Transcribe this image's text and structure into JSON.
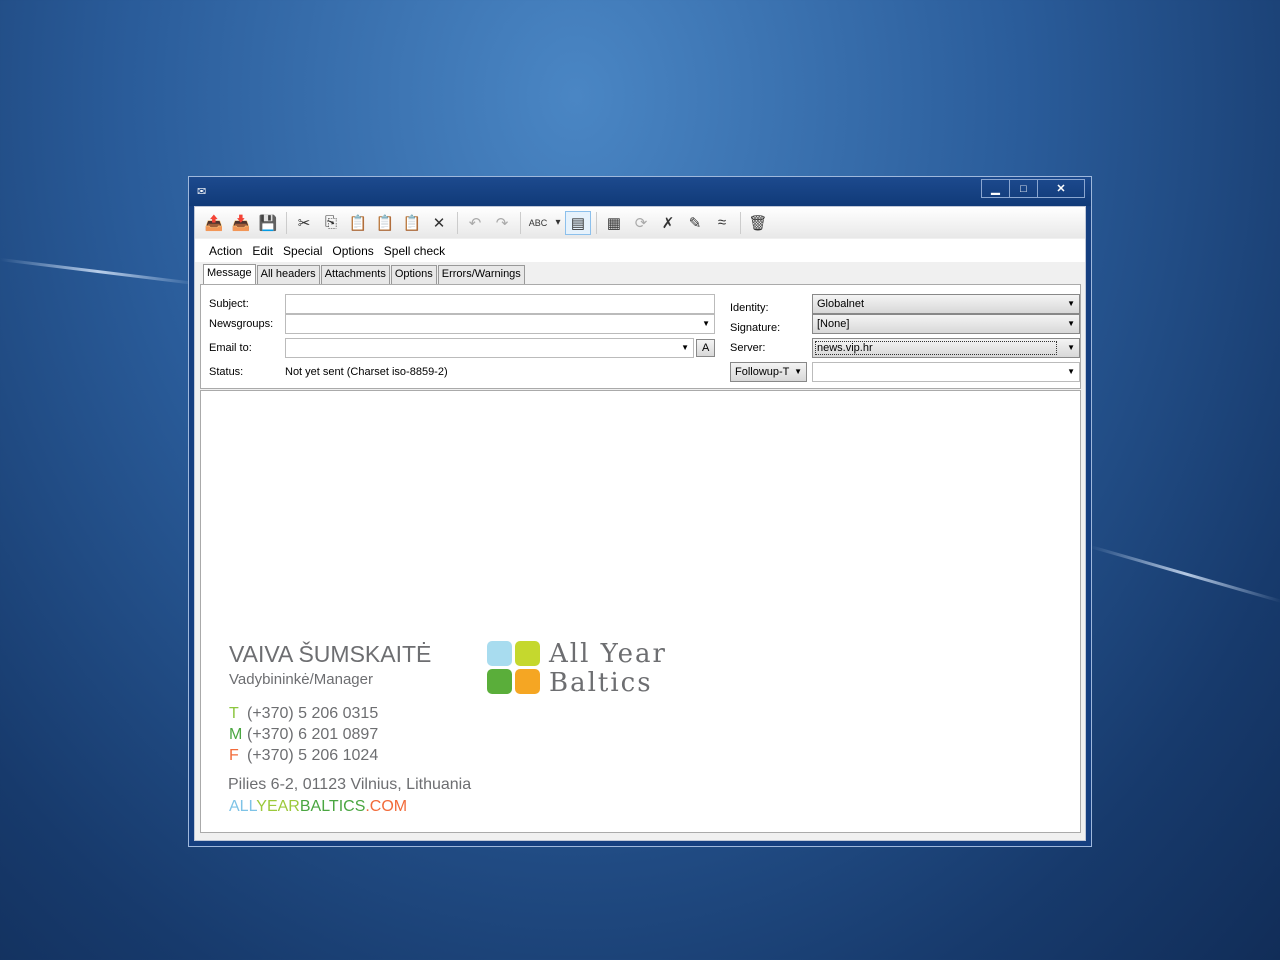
{
  "window": {
    "app_icon": "envelope-icon",
    "minimize": "▁",
    "maximize": "□",
    "close": "✕"
  },
  "toolbar": {
    "buttons": [
      {
        "name": "send-icon",
        "glyph": "📤"
      },
      {
        "name": "send-later-icon",
        "glyph": "📥"
      },
      {
        "name": "save-icon",
        "glyph": "💾"
      },
      {
        "name": "cut-icon",
        "glyph": "✂"
      },
      {
        "name": "copy-icon",
        "glyph": "⎘"
      },
      {
        "name": "paste-icon",
        "glyph": "📋"
      },
      {
        "name": "paste-quoted-icon",
        "glyph": "📋"
      },
      {
        "name": "paste-special-icon",
        "glyph": "📋"
      },
      {
        "name": "delete-icon",
        "glyph": "✕"
      },
      {
        "name": "undo-icon",
        "glyph": "↶"
      },
      {
        "name": "redo-icon",
        "glyph": "↷"
      },
      {
        "name": "spell-check-icon",
        "glyph": "ABC"
      },
      {
        "name": "spell-dropdown-icon",
        "glyph": "▾"
      },
      {
        "name": "wrap-icon",
        "glyph": "▤"
      },
      {
        "name": "insert-file-icon",
        "glyph": "▦"
      },
      {
        "name": "rot13-icon",
        "glyph": "⟳"
      },
      {
        "name": "remove-signature-icon",
        "glyph": "✗"
      },
      {
        "name": "edit-text-icon",
        "glyph": "✎"
      },
      {
        "name": "reformat-icon",
        "glyph": "≈"
      },
      {
        "name": "discard-icon",
        "glyph": "🗑"
      }
    ]
  },
  "menu": [
    "Action",
    "Edit",
    "Special",
    "Options",
    "Spell check"
  ],
  "tabs": [
    "Message",
    "All headers",
    "Attachments",
    "Options",
    "Errors/Warnings"
  ],
  "form": {
    "subject_label": "Subject:",
    "subject_value": "",
    "newsgroups_label": "Newsgroups:",
    "newsgroups_value": "",
    "email_label": "Email to:",
    "email_value": "",
    "address_button": "A",
    "status_label": "Status:",
    "status_value": "Not yet sent (Charset iso-8859-2)",
    "identity_label": "Identity:",
    "identity_value": "Globalnet",
    "signature_label": "Signature:",
    "signature_value": "[None]",
    "server_label": "Server:",
    "server_value": "news.vip.hr",
    "followup_button": "Followup-T",
    "followup_value": ""
  },
  "signature": {
    "name": "VAIVA ŠUMSKAITĖ",
    "title": "Vadybininkė/Manager",
    "phones": [
      {
        "prefix": "T",
        "number": "(+370) 5 206 0315",
        "color": "#8cc63f"
      },
      {
        "prefix": "M",
        "number": "(+370) 6 201 0897",
        "color": "#4aa641"
      },
      {
        "prefix": "F",
        "number": "(+370) 5 206 1024",
        "color": "#f26b3a"
      }
    ],
    "address": "Pilies 6-2, 01123 Vilnius, Lithuania",
    "web": [
      {
        "text": "ALL",
        "color": "#7ec3e6"
      },
      {
        "text": "YEAR",
        "color": "#9cc93b"
      },
      {
        "text": "BALTICS",
        "color": "#4aa641"
      },
      {
        "text": ".COM",
        "color": "#f26b3a"
      }
    ],
    "logo_line1": "All Year",
    "logo_line2": "Baltics",
    "logo_colors": [
      "#a8dcef",
      "#c5d82e",
      "#5aae3a",
      "#f5a623"
    ]
  }
}
